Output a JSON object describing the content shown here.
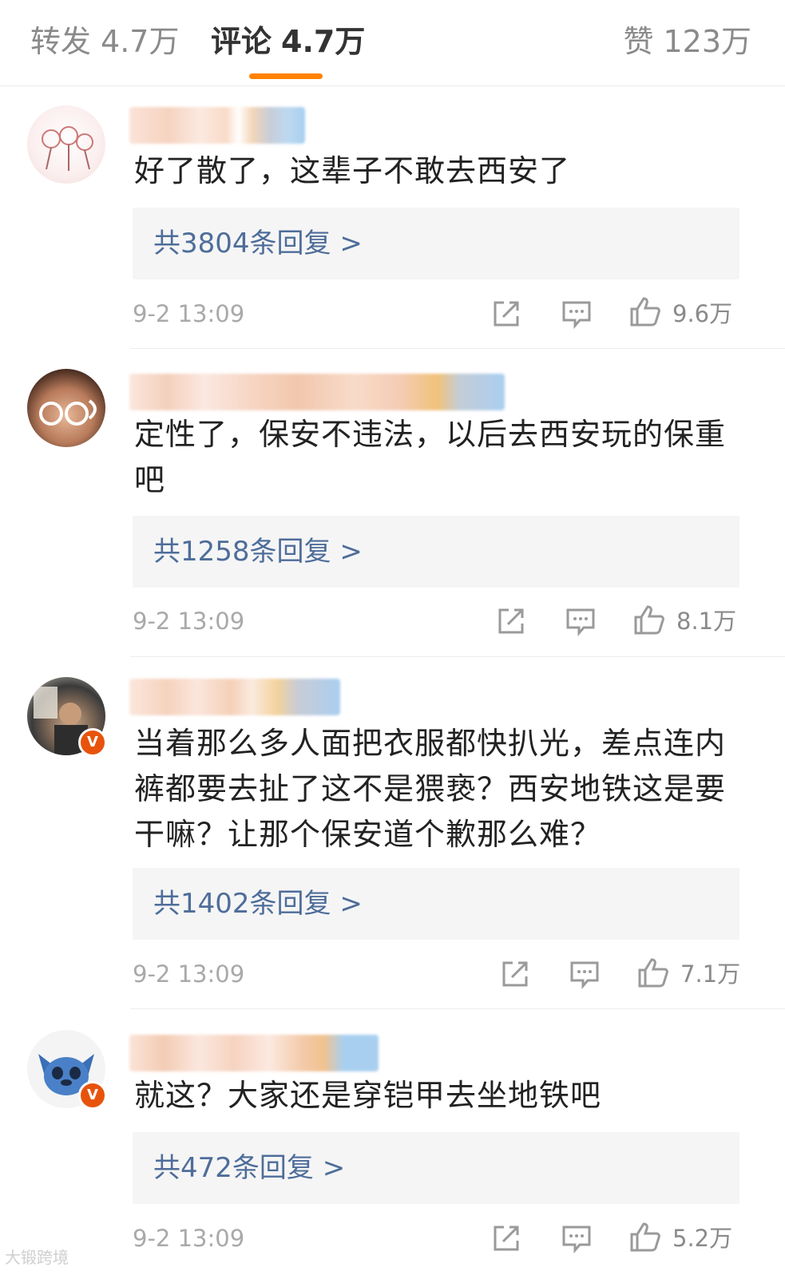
{
  "tabs": {
    "repost": {
      "label": "转发",
      "count": "4.7万"
    },
    "comments": {
      "label": "评论",
      "count": "4.7万"
    },
    "likes": {
      "label": "赞",
      "count": "123万"
    }
  },
  "colors": {
    "accent": "#ff8200",
    "reply_link": "#4e6d9a",
    "verified_badge": "#e8530c"
  },
  "comments": [
    {
      "text": "好了散了，这辈子不敢去西安了",
      "replies": "共3804条回复 >",
      "time": "9-2 13:09",
      "likes": "9.6万",
      "verified": false
    },
    {
      "text": "定性了，保安不违法，以后去西安玩的保重吧",
      "replies": "共1258条回复 >",
      "time": "9-2 13:09",
      "likes": "8.1万",
      "verified": false
    },
    {
      "text": "当着那么多人面把衣服都快扒光，差点连内裤都要去扯了这不是猥亵？西安地铁这是要干嘛？让那个保安道个歉那么难？",
      "replies": "共1402条回复 >",
      "time": "9-2 13:09",
      "likes": "7.1万",
      "verified": true
    },
    {
      "text": "就这？大家还是穿铠甲去坐地铁吧",
      "replies": "共472条回复 >",
      "time": "9-2 13:09",
      "likes": "5.2万",
      "verified": true
    }
  ],
  "badges": {
    "verified_letter": "V"
  },
  "watermark": "大锻跨境",
  "icons": [
    "share-icon",
    "comment-icon",
    "thumbs-up-icon",
    "verified-badge-icon"
  ]
}
